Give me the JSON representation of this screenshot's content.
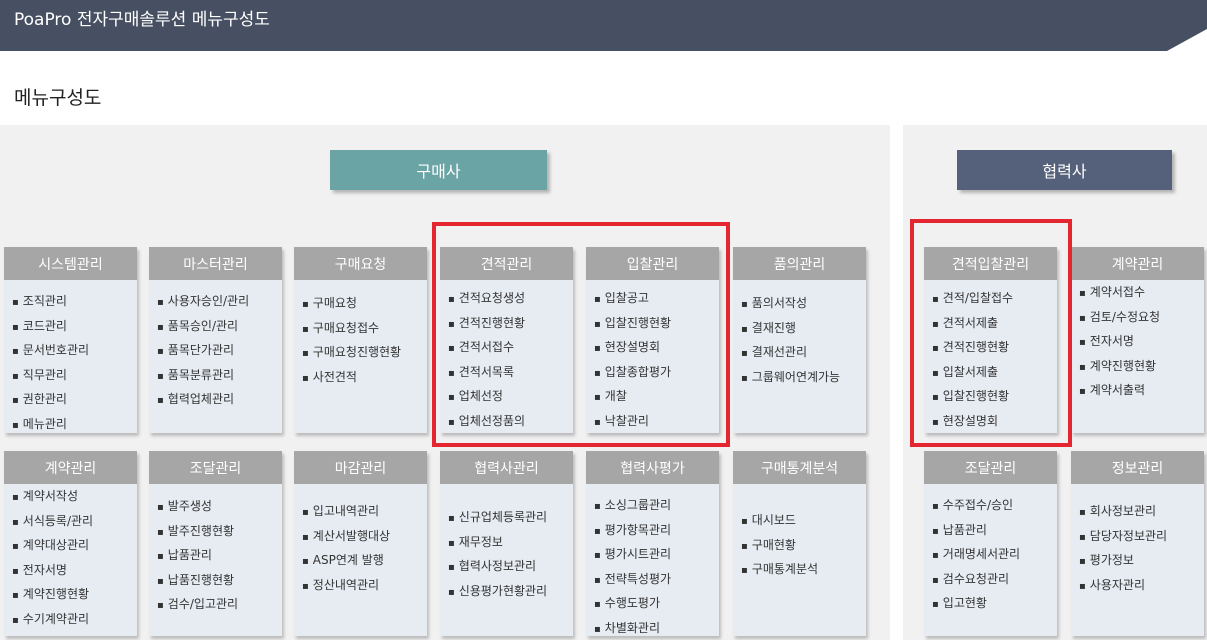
{
  "header": {
    "title": "PoaPro 전자구매솔루션 메뉴구성도"
  },
  "section_title": "메뉴구성도",
  "roles": {
    "buyer": "구매사",
    "partner": "협력사"
  },
  "cards": [
    {
      "title": "시스템관리",
      "items": [
        "조직관리",
        "코드관리",
        "문서번호관리",
        "직무관리",
        "권한관리",
        "메뉴관리"
      ]
    },
    {
      "title": "마스터관리",
      "items": [
        "사용자승인/관리",
        "품목승인/관리",
        "품목단가관리",
        "품목분류관리",
        "협력업체관리"
      ]
    },
    {
      "title": "구매요청",
      "items": [
        "구매요청",
        "구매요청접수",
        "구매요청진행현황",
        "사전견적"
      ]
    },
    {
      "title": "견적관리",
      "items": [
        "견적요청생성",
        "견적진행현황",
        "견적서접수",
        "견적서목록",
        "업체선정",
        "업체선정품의"
      ]
    },
    {
      "title": "입찰관리",
      "items": [
        "입찰공고",
        "입찰진행현황",
        "현장설명회",
        "입찰종합평가",
        "개찰",
        "낙찰관리"
      ]
    },
    {
      "title": "품의관리",
      "items": [
        "품의서작성",
        "결재진행",
        "결재선관리",
        "그룹웨어연계가능"
      ]
    },
    {
      "title": "계약관리",
      "items": [
        "계약서작성",
        "서식등록/관리",
        "계약대상관리",
        "전자서명",
        "계약진행현황",
        "수기계약관리"
      ]
    },
    {
      "title": "조달관리",
      "items": [
        "발주생성",
        "발주진행현황",
        "납품관리",
        "납품진행현황",
        "검수/입고관리"
      ]
    },
    {
      "title": "마감관리",
      "items": [
        "입고내역관리",
        "계산서발행대상",
        "ASP연계 발행",
        "정산내역관리"
      ]
    },
    {
      "title": "협력사관리",
      "items": [
        "신규업체등록관리",
        "재무정보",
        "협력사정보관리",
        "신용평가현황관리"
      ]
    },
    {
      "title": "협력사평가",
      "items": [
        "소싱그룹관리",
        "평가항목관리",
        "평가시트관리",
        "전략특성평가",
        "수행도평가",
        "차별화관리"
      ]
    },
    {
      "title": "구매통계분석",
      "items": [
        "대시보드",
        "구매현황",
        "구매통계분석"
      ]
    },
    {
      "title": "견적입찰관리",
      "items": [
        "견적/입찰접수",
        "견적서제출",
        "견적진행현황",
        "입찰서제출",
        "입찰진행현황",
        "현장설명회"
      ]
    },
    {
      "title": "계약관리",
      "items": [
        "계약서접수",
        "검토/수정요청",
        "전자서명",
        "계약진행현황",
        "계약서출력"
      ]
    },
    {
      "title": "조달관리",
      "items": [
        "수주접수/승인",
        "납품관리",
        "거래명세서관리",
        "검수요청관리",
        "입고현황"
      ]
    },
    {
      "title": "정보관리",
      "items": [
        "회사정보관리",
        "담당자정보관리",
        "평가정보",
        "사용자관리"
      ]
    }
  ]
}
